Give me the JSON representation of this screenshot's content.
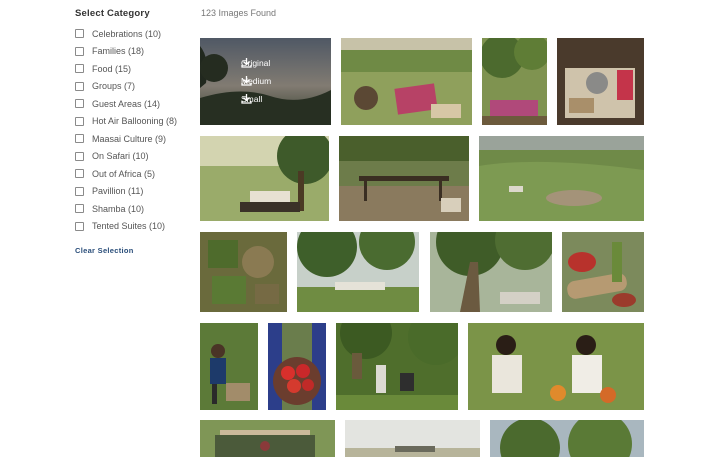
{
  "sidebar": {
    "title": "Select Category",
    "categories": [
      {
        "label": "Celebrations (10)"
      },
      {
        "label": "Families (18)"
      },
      {
        "label": "Food (15)"
      },
      {
        "label": "Groups (7)"
      },
      {
        "label": "Guest Areas (14)"
      },
      {
        "label": "Hot Air Ballooning (8)"
      },
      {
        "label": "Maasai Culture (9)"
      },
      {
        "label": "On Safari (10)"
      },
      {
        "label": "Out of Africa (5)"
      },
      {
        "label": "Pavillion (11)"
      },
      {
        "label": "Shamba (10)"
      },
      {
        "label": "Tented Suites (10)"
      }
    ],
    "clear_label": "Clear Selection"
  },
  "results": {
    "count_text": "123 Images Found"
  },
  "download_menu": {
    "original": "Original",
    "medium": "Medium",
    "small": "Small",
    "icon": "download-icon"
  }
}
